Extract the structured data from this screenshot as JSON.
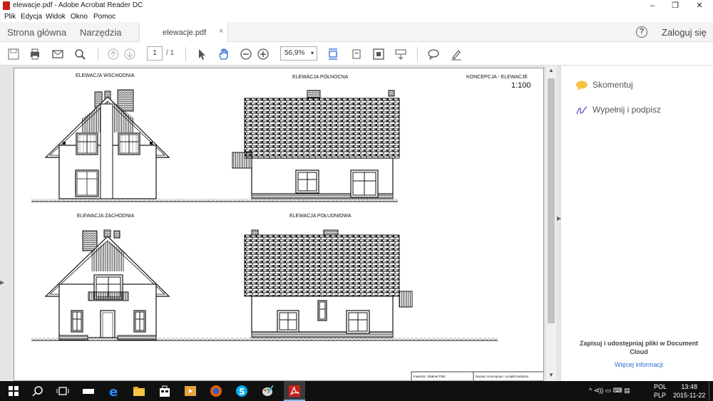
{
  "window": {
    "title": "elewacje.pdf - Adobe Acrobat Reader DC",
    "minimize": "–",
    "maximize": "❐",
    "close": "✕"
  },
  "menu": [
    "Plik",
    "Edycja",
    "Widok",
    "Okno",
    "Pomoc"
  ],
  "tabs": {
    "home": "Strona główna",
    "tools": "Narzędzia",
    "document": "elewacje.pdf",
    "close": "×"
  },
  "header": {
    "help": "?",
    "login": "Zaloguj się"
  },
  "toolbar": {
    "page_current": "1",
    "page_total": "/ 1",
    "zoom": "56,9%",
    "zoom_arrow": "▾"
  },
  "drawing": {
    "title_east": "ELEWACJA WSCHODNIA",
    "title_north": "ELEWACJA PÓŁNOCNA",
    "title_west": "ELEWACJA ZACHODNIA",
    "title_south": "ELEWACJA POŁUDNIOWA",
    "concept": "KONCEPCJA - ELEWACJE",
    "scale": "1:100",
    "investor": "Inwestor: Skalnet Plotr",
    "project": "Nazwa: Koncepcja + projekt budynku"
  },
  "right_panel": {
    "comment": "Skomentuj",
    "fill_sign": "Wypełnij i podpisz",
    "promo": "Zapisuj i udostępniaj pliki w Document Cloud",
    "more": "Więcej informacji"
  },
  "taskbar": {
    "lang_top": "POL",
    "lang_bottom": "PLP",
    "time": "13:48",
    "date": "2015-11-22",
    "tray": "^ ⊲)) ▭ ⌨ ▤"
  },
  "colors": {
    "accent": "#2a6ad3",
    "acrobat_red": "#c8201e",
    "taskbar": "#101010"
  }
}
